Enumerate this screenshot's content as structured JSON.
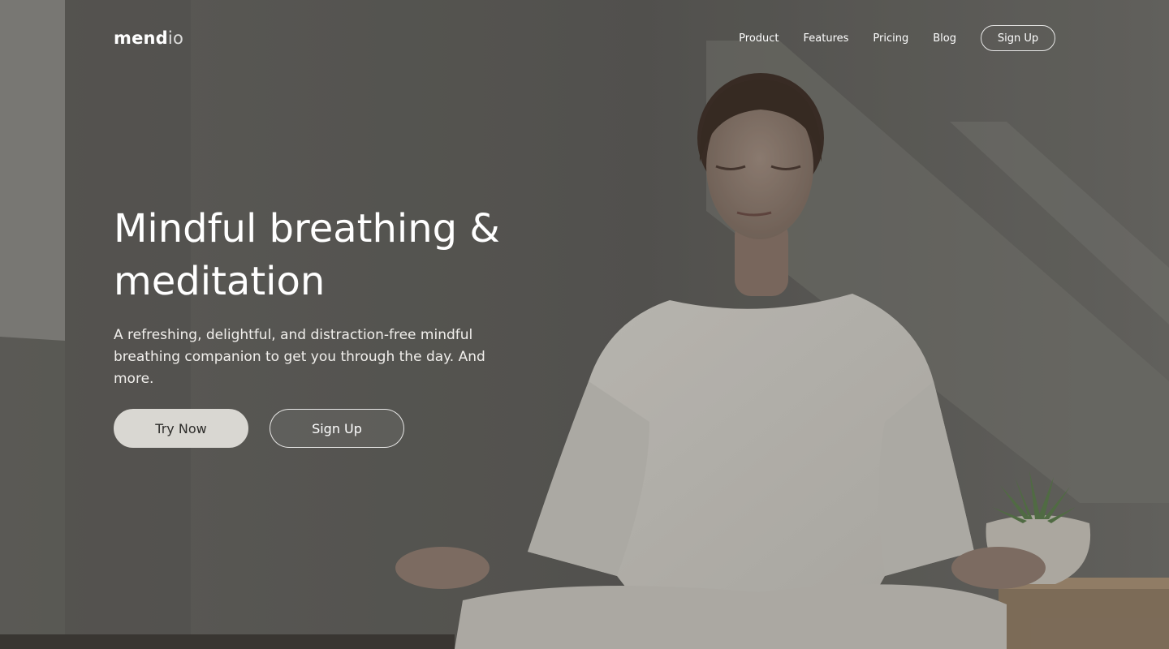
{
  "brand": {
    "logo_main": "mend",
    "logo_accent": "io"
  },
  "nav": {
    "items": [
      {
        "label": "Product"
      },
      {
        "label": "Features"
      },
      {
        "label": "Pricing"
      },
      {
        "label": "Blog"
      }
    ],
    "signup_label": "Sign Up"
  },
  "hero": {
    "title": "Mindful breathing & meditation",
    "subtitle": "A refreshing, delightful, and distraction-free mindful breathing companion to get you through the day. And more.",
    "primary_cta": "Try Now",
    "secondary_cta": "Sign Up"
  },
  "colors": {
    "overlay": "#5c5b58",
    "button_primary_bg": "#d9d7d2",
    "button_primary_text": "#2d2c2a",
    "text": "#ffffff"
  }
}
